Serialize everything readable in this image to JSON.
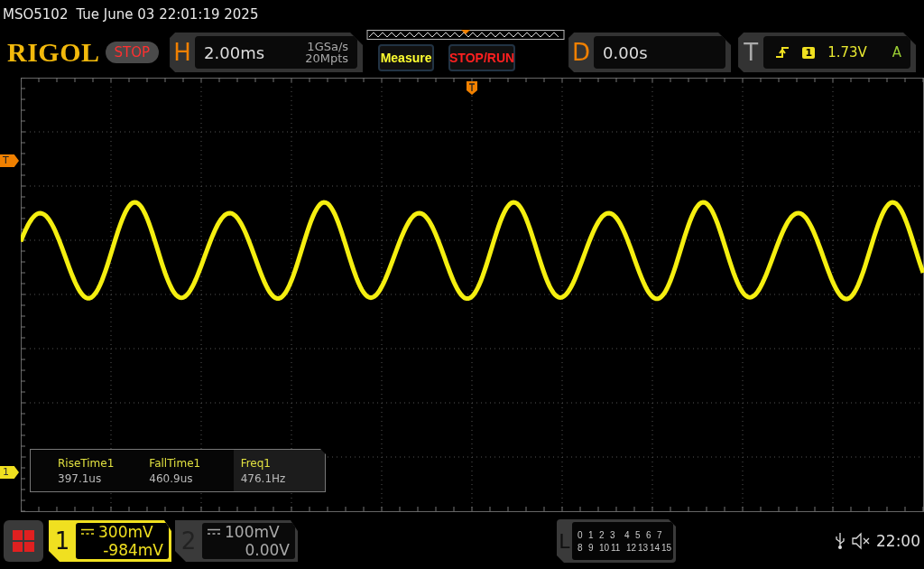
{
  "header": {
    "model": "MSO5102",
    "datetime": "Tue June 03 22:01:19 2025"
  },
  "logo": "RIGOL",
  "run_state": "STOP",
  "horizontal": {
    "letter": "H",
    "timebase": "2.00ms",
    "sample_rate": "1GSa/s",
    "memory_depth": "20Mpts"
  },
  "buttons": [
    {
      "label": "Measure",
      "kind": "measure"
    },
    {
      "label": "STOP/RUN",
      "kind": "stoprun"
    }
  ],
  "delay": {
    "letter": "D",
    "value": "0.00s"
  },
  "trigger": {
    "letter": "T",
    "source": "1",
    "level": "1.73V",
    "mode": "A"
  },
  "markers": {
    "trigger": "T",
    "channel": "1"
  },
  "measurements": [
    {
      "name": "RiseTime1",
      "value": "397.1us",
      "selected": false
    },
    {
      "name": "FallTime1",
      "value": "460.9us",
      "selected": false
    },
    {
      "name": "Freq1",
      "value": "476.1Hz",
      "selected": true
    }
  ],
  "channels": [
    {
      "number": "1",
      "scale": "300mV",
      "offset": "-984mV",
      "active": true
    },
    {
      "number": "2",
      "scale": "100mV",
      "offset": "0.00V",
      "active": false
    }
  ],
  "logic": {
    "letter": "L",
    "rows": [
      [
        "0",
        "1",
        "2",
        "3",
        "4",
        "5",
        "6",
        "7"
      ],
      [
        "8",
        "9",
        "10",
        "11",
        "12",
        "13",
        "14",
        "15"
      ]
    ]
  },
  "status": {
    "time": "22:00"
  }
}
